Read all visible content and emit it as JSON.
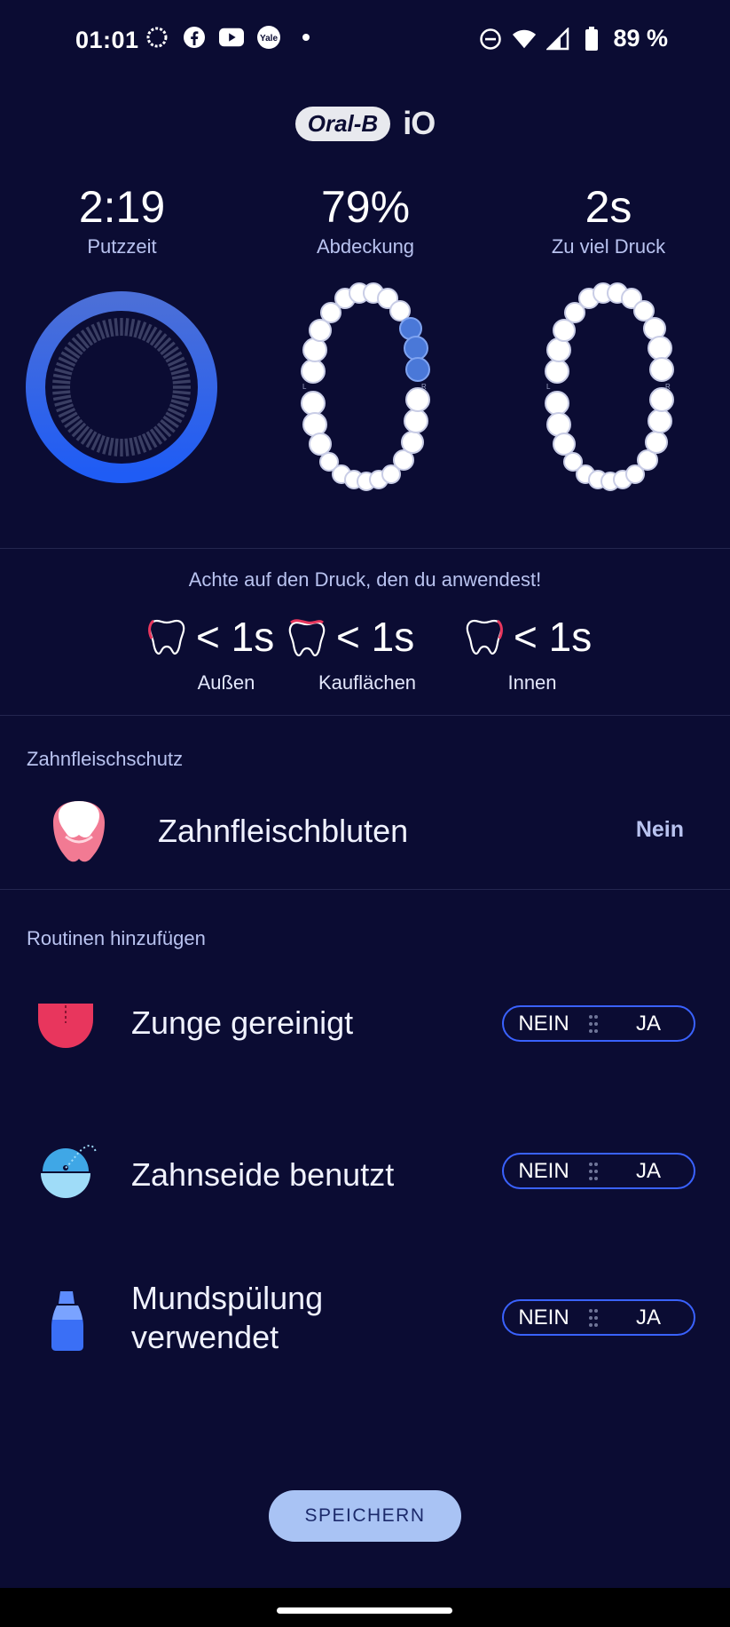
{
  "status_bar": {
    "time": "01:01",
    "left_icons": [
      "signal-messenger-icon",
      "facebook-icon",
      "youtube-icon",
      "yale-icon",
      "dot-icon"
    ],
    "right_icons": [
      "dnd-icon",
      "wifi-icon",
      "cell-signal-icon",
      "battery-icon"
    ],
    "battery_percent": "89 %"
  },
  "header": {
    "brand": "Oral-B",
    "model": "iO"
  },
  "stats": [
    {
      "value": "2:19",
      "label": "Putzzeit"
    },
    {
      "value": "79%",
      "label": "Abdeckung"
    },
    {
      "value": "2s",
      "label": "Zu viel Druck"
    }
  ],
  "pressure": {
    "hint": "Achte auf den Druck, den du anwendest!",
    "items": [
      {
        "value": "< 1s",
        "label": "Außen"
      },
      {
        "value": "< 1s",
        "label": "Kauflächen"
      },
      {
        "value": "< 1s",
        "label": "Innen"
      }
    ]
  },
  "gum": {
    "section_title": "Zahnfleischschutz",
    "label": "Zahnfleischbluten",
    "value": "Nein"
  },
  "routines": {
    "section_title": "Routinen hinzufügen",
    "items": [
      {
        "label": "Zunge gereinigt",
        "no": "NEIN",
        "yes": "JA"
      },
      {
        "label": "Zahnseide benutzt",
        "no": "NEIN",
        "yes": "JA"
      },
      {
        "label_line1": "Mundspülung",
        "label_line2": "verwendet",
        "no": "NEIN",
        "yes": "JA"
      }
    ]
  },
  "save_button": "SPEICHERN",
  "colors": {
    "background": "#0b0c33",
    "accent_blue": "#3a62ff",
    "label_blue": "#b9c3f0",
    "button_bg": "#a9c3f4",
    "tongue_red": "#e8365d",
    "gum_pink": "#f27a93"
  }
}
